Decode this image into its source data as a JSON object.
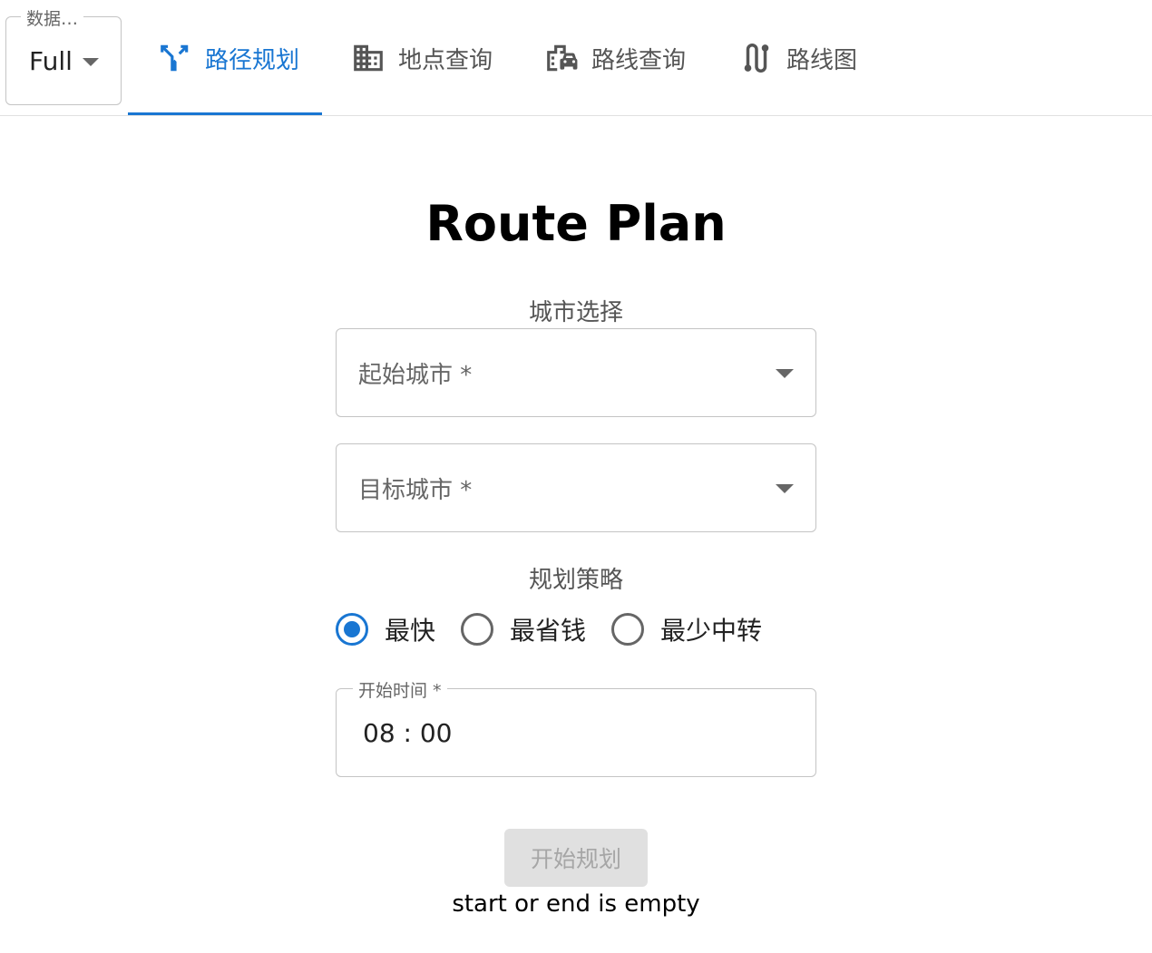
{
  "dataset": {
    "legend": "数据…",
    "value": "Full"
  },
  "tabs": [
    {
      "label": "路径规划",
      "icon": "fork-arrows-icon",
      "active": true
    },
    {
      "label": "地点查询",
      "icon": "building-icon",
      "active": false
    },
    {
      "label": "路线查询",
      "icon": "city-car-icon",
      "active": false
    },
    {
      "label": "路线图",
      "icon": "route-icon",
      "active": false
    }
  ],
  "accent_color": "#1976d2",
  "main": {
    "title": "Route Plan",
    "city_section_label": "城市选择",
    "start_city": {
      "label": "起始城市 *",
      "value": ""
    },
    "target_city": {
      "label": "目标城市 *",
      "value": ""
    },
    "strategy_section_label": "规划策略",
    "strategies": [
      {
        "label": "最快",
        "checked": true
      },
      {
        "label": "最省钱",
        "checked": false
      },
      {
        "label": "最少中转",
        "checked": false
      }
    ],
    "start_time": {
      "label": "开始时间 *",
      "value": "08 : 00"
    },
    "plan_button": {
      "label": "开始规划",
      "disabled": true
    },
    "status_message": "start or end is empty"
  }
}
